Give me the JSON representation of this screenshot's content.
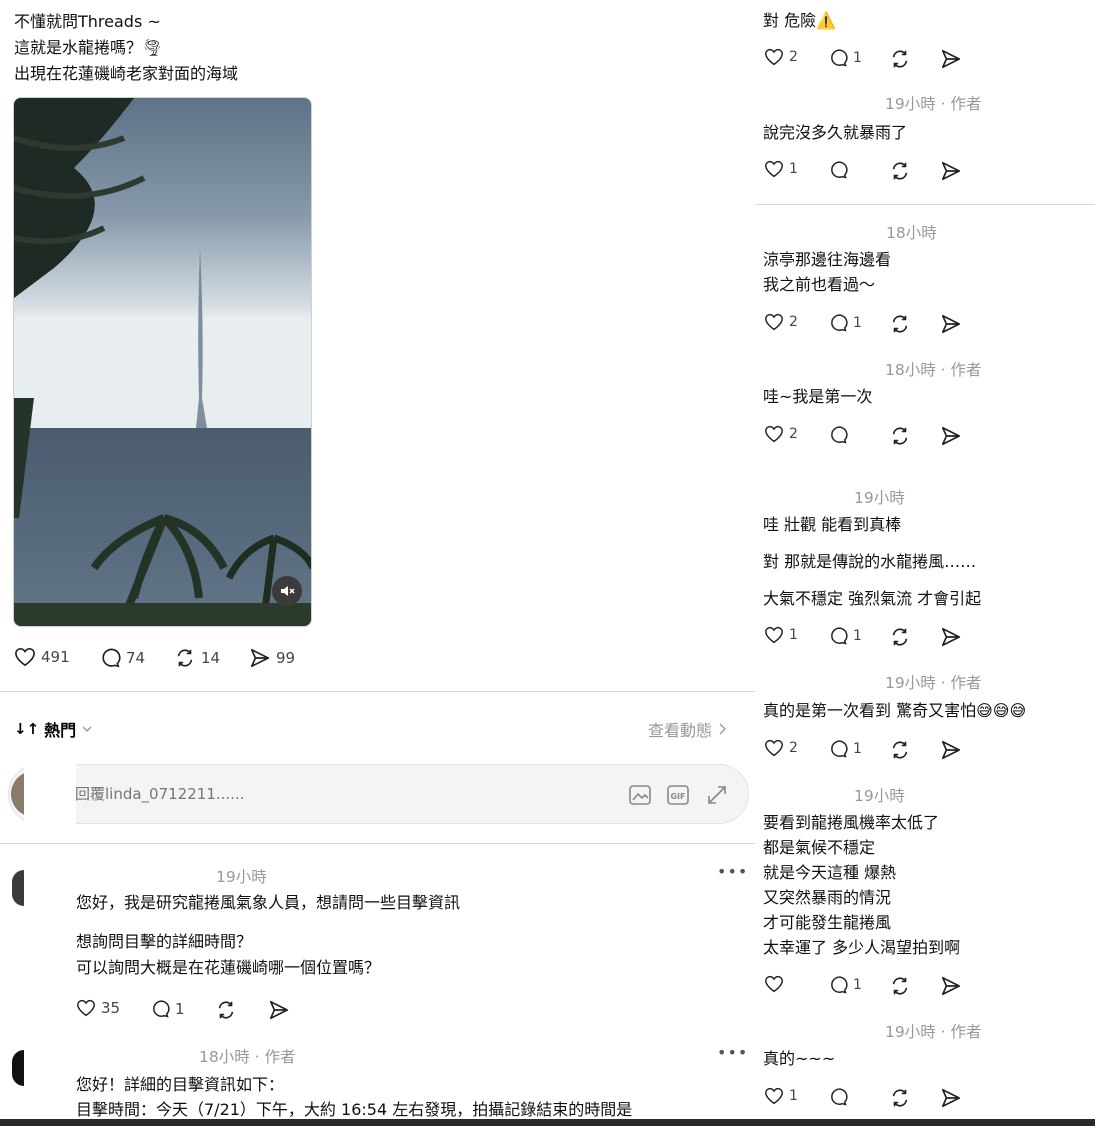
{
  "post": {
    "lines": [
      "不懂就問Threads ~",
      "這就是水龍捲嗎？🌪",
      "出現在花蓮磯崎老家對面的海域"
    ],
    "likes": "491",
    "replies": "74",
    "reposts": "14",
    "shares": "99"
  },
  "sort": {
    "label": "熱門",
    "view_activity": "查看動態"
  },
  "reply_input": {
    "placeholder": "回覆linda_0712211......"
  },
  "left_comments": [
    {
      "time": "19小時",
      "lines": [
        "您好，我是研究龍捲風氣象人員，想請問一些目擊資訊",
        "",
        "想詢問目擊的詳細時間？",
        "可以詢問大概是在花蓮磯崎哪一個位置嗎？"
      ],
      "likes": "35",
      "replies": "1"
    },
    {
      "time": "18小時 · 作者",
      "lines": [
        "您好！詳細的目擊資訊如下：",
        "目擊時間：今天（7/21）下午，大約 16:54 左右發現，拍攝記錄結束的時間是"
      ]
    }
  ],
  "right_comments": [
    {
      "time": "",
      "lines": [
        "對 危險⚠️"
      ],
      "likes": "2",
      "replies": "1"
    },
    {
      "time": "19小時 · 作者",
      "lines": [
        "說完沒多久就暴雨了"
      ],
      "likes": "1",
      "replies": ""
    },
    {
      "time": "18小時",
      "lines": [
        "涼亭那邊往海邊看",
        "我之前也看過～"
      ],
      "likes": "2",
      "replies": "1"
    },
    {
      "time": "18小時 · 作者",
      "lines": [
        "哇~我是第一次"
      ],
      "likes": "2",
      "replies": ""
    },
    {
      "time": "19小時",
      "lines": [
        "哇 壯觀 能看到真棒",
        "對 那就是傳說的水龍捲風……",
        "大氣不穩定 強烈氣流 才會引起"
      ],
      "likes": "1",
      "replies": "1"
    },
    {
      "time": "19小時 · 作者",
      "lines": [
        "真的是第一次看到 驚奇又害怕😅😅😅"
      ],
      "likes": "2",
      "replies": "1"
    },
    {
      "time": "19小時",
      "lines": [
        "要看到龍捲風機率太低了",
        "都是氣候不穩定",
        "就是今天這種 爆熱",
        "又突然暴雨的情況",
        "才可能發生龍捲風",
        "太幸運了 多少人渴望拍到啊"
      ],
      "likes": "",
      "replies": "1"
    },
    {
      "time": "19小時 · 作者",
      "lines": [
        "真的~~~"
      ],
      "likes": "1",
      "replies": ""
    }
  ],
  "icons": {
    "like": "heart-icon",
    "reply": "comment-icon",
    "repost": "repost-icon",
    "share": "share-icon",
    "mute": "mute-icon",
    "image": "image-icon",
    "gif": "gif-icon",
    "expand": "expand-icon",
    "more": "more-icon",
    "sort": "sort-icon",
    "chevron": "chevron-right-icon"
  }
}
